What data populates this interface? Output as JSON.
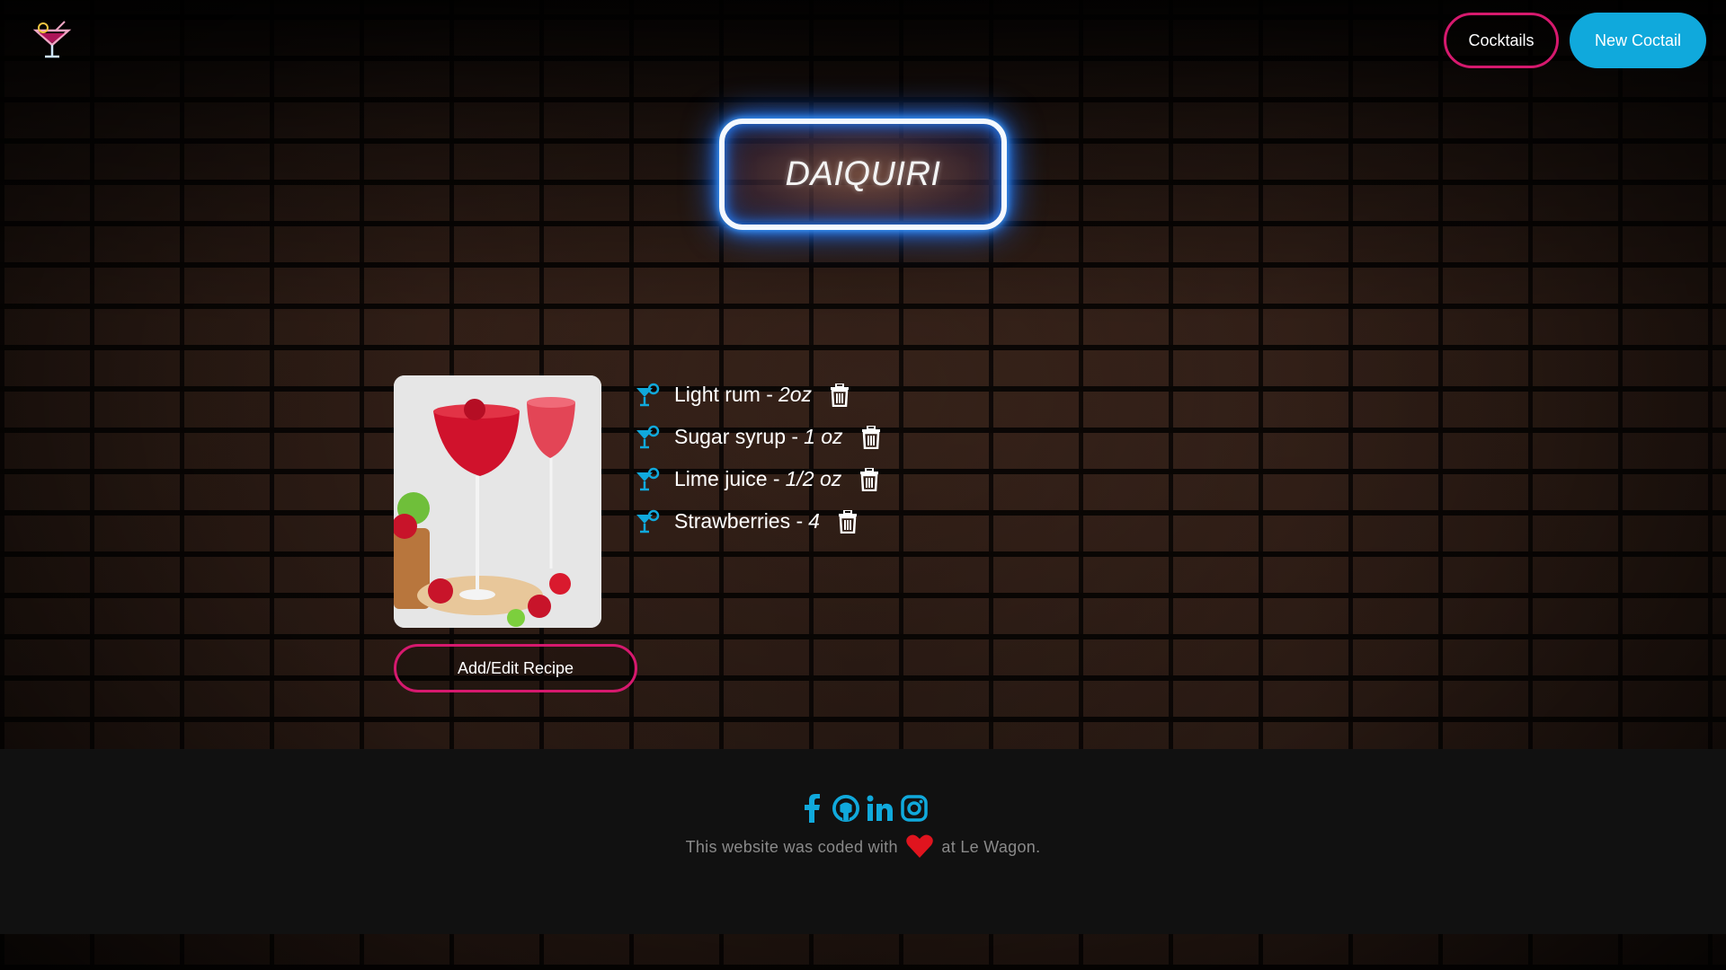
{
  "navbar": {
    "logo_icon": "cocktail-glass-icon",
    "cocktails_label": "Cocktails",
    "new_cocktail_label": "New Coctail"
  },
  "cocktail": {
    "name": "DAIQUIRI",
    "image_icon": "strawberry-daiquiri-photo",
    "ingredients": [
      {
        "name": "Light rum -",
        "amount": "2oz"
      },
      {
        "name": "Sugar syrup -",
        "amount": "1 oz"
      },
      {
        "name": "Lime juice -",
        "amount": "1/2 oz"
      },
      {
        "name": "Strawberries -",
        "amount": "4"
      }
    ],
    "recipe_button_label": "Add/Edit Recipe"
  },
  "footer": {
    "social_icons": [
      "facebook-icon",
      "github-icon",
      "linkedin-icon",
      "instagram-icon"
    ],
    "text_before": "This website was coded with",
    "text_after": "at Le Wagon."
  },
  "colors": {
    "accent_pink": "#d6196e",
    "accent_blue": "#10a9dc",
    "neon_blue": "#2b86ff",
    "heart_red": "#e0141e",
    "footer_bg": "#111111"
  }
}
